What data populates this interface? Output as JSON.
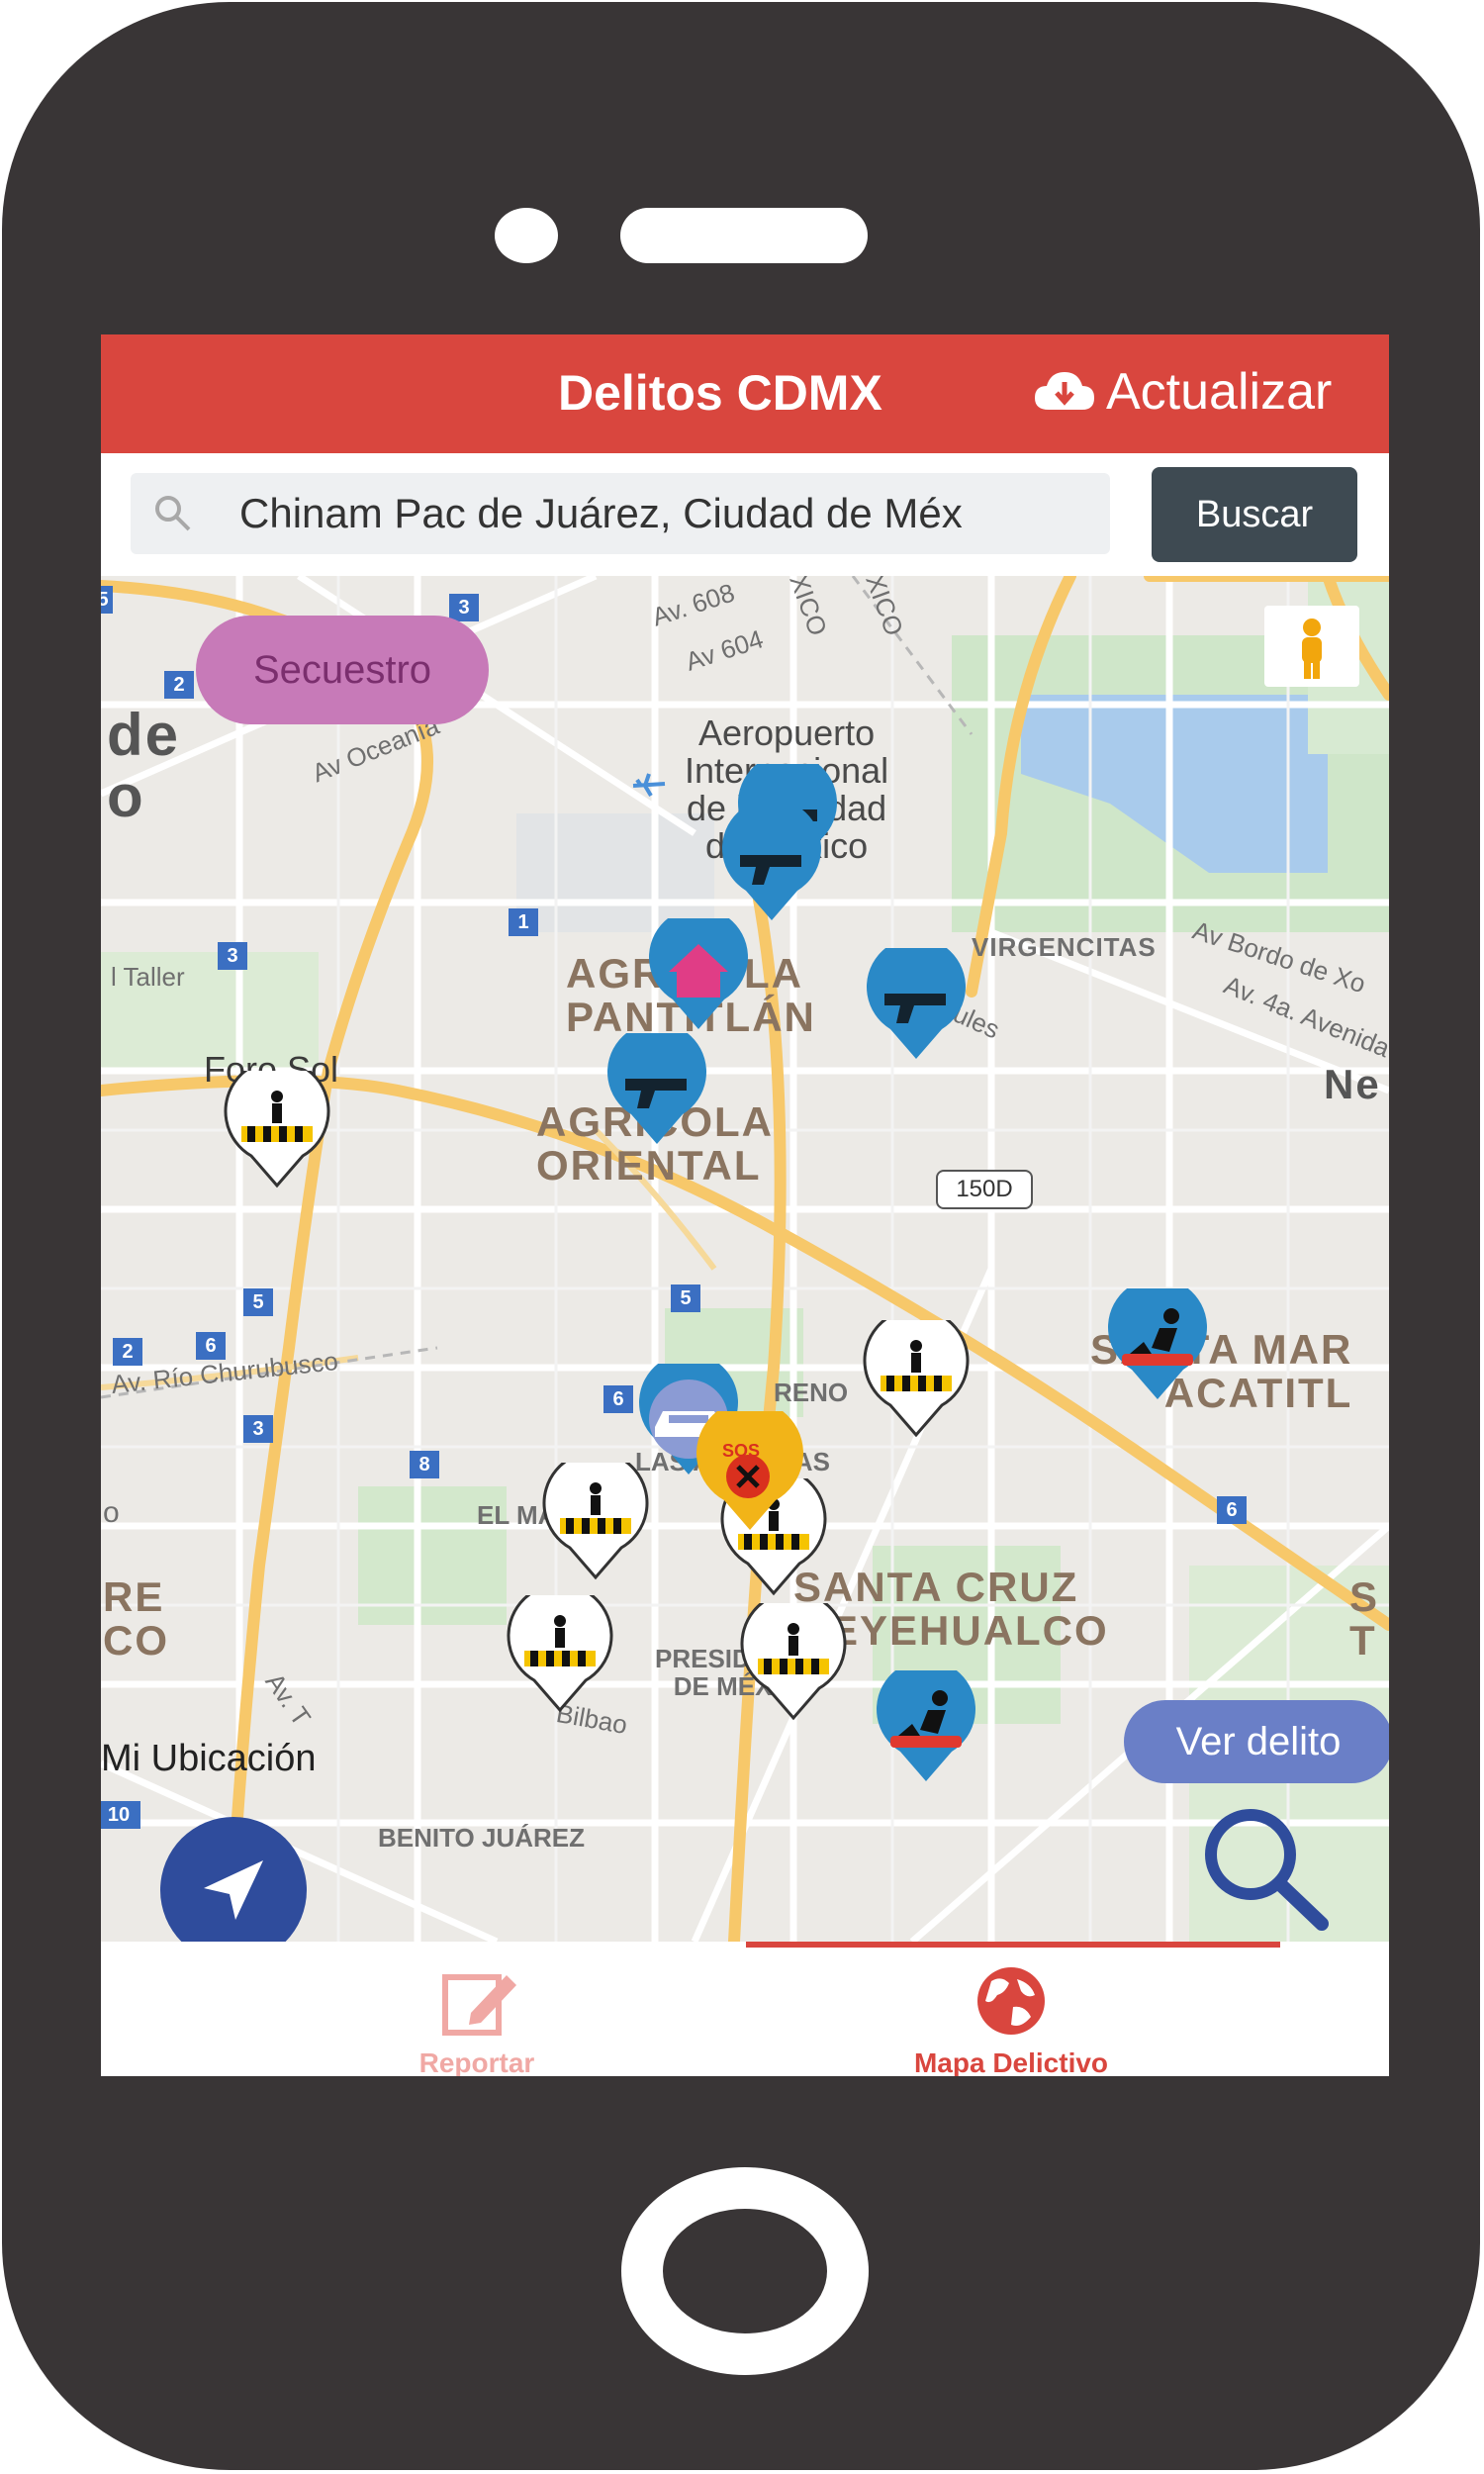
{
  "header": {
    "title": "Delitos CDMX",
    "refresh_label": "Actualizar",
    "refresh_icon": "cloud-download-icon"
  },
  "search": {
    "value": "Chinam Pac de Juárez, Ciudad de Méx",
    "button_label": "Buscar",
    "icon": "search-icon"
  },
  "map": {
    "chip_top": "Secuestro",
    "chip_bottom": "Ver delito",
    "my_location_label": "Mi Ubicación",
    "labels": {
      "airport": [
        "Aeropuerto",
        "Internacional",
        "de la Ciudad",
        "de México"
      ],
      "agricola_pantitlan": [
        "AGRÍCOLA",
        "PANTITLÁN"
      ],
      "agricola_oriental": [
        "AGRÍCOLA",
        "ORIENTAL"
      ],
      "santa_martha": [
        "SANTA MAR",
        "ACATITL"
      ],
      "santa_cruz": [
        "SANTA CRUZ",
        "MEYEHUALCO"
      ],
      "foro_sol": "Foro Sol",
      "av_oceania": "Av Oceanía",
      "av_604": "Av 604",
      "av_608": "Av. 608",
      "virgencitas": "VIRGENCITAS",
      "av_bordo": "Av Bordo de Xo",
      "av_pirules": "Av. Pirules",
      "av_4a": "Av. 4a. Avenida",
      "av_rio": "Av. Río Churubusco",
      "taller": "l Taller",
      "renov": "RENO",
      "las_americas": "LAS AMÉRICAS",
      "el_manto": "EL MA",
      "presidentes": [
        "PRESIDENTES",
        "DE MÉXICO"
      ],
      "bilbao": "Bilbao",
      "benito": "BENITO JUÁREZ",
      "av_tlahuac": "Av. T",
      "ne": "Ne",
      "de_o": [
        "de",
        "o"
      ],
      "re_co": [
        "RE",
        "CO"
      ],
      "s_t": [
        "S",
        "T"
      ],
      "hwy_150d": "150D",
      "edge_o": "o",
      "mexico_1": "XICO",
      "mexico_2": "XICO"
    },
    "shields": [
      "3",
      "2",
      "1",
      "3",
      "5",
      "2",
      "6",
      "3",
      "6",
      "8",
      "5",
      "6",
      "10",
      "5"
    ],
    "markers": [
      "gun",
      "gun",
      "house",
      "gun",
      "gun",
      "pedestrian",
      "pedestrian",
      "car",
      "sos",
      "pedestrian",
      "pedestrian",
      "pedestrian",
      "pedestrian",
      "pedestrian",
      "robbery",
      "robbery"
    ]
  },
  "tabs": [
    {
      "label": "Reportar",
      "icon": "edit-icon",
      "active": false
    },
    {
      "label": "Mapa Delictivo",
      "icon": "globe-icon",
      "active": true
    }
  ],
  "colors": {
    "primary": "#d9463e",
    "marker_blue": "#2a89c7",
    "chip_purple": "#c77ab8",
    "chip_blue": "#6a7fc7"
  }
}
